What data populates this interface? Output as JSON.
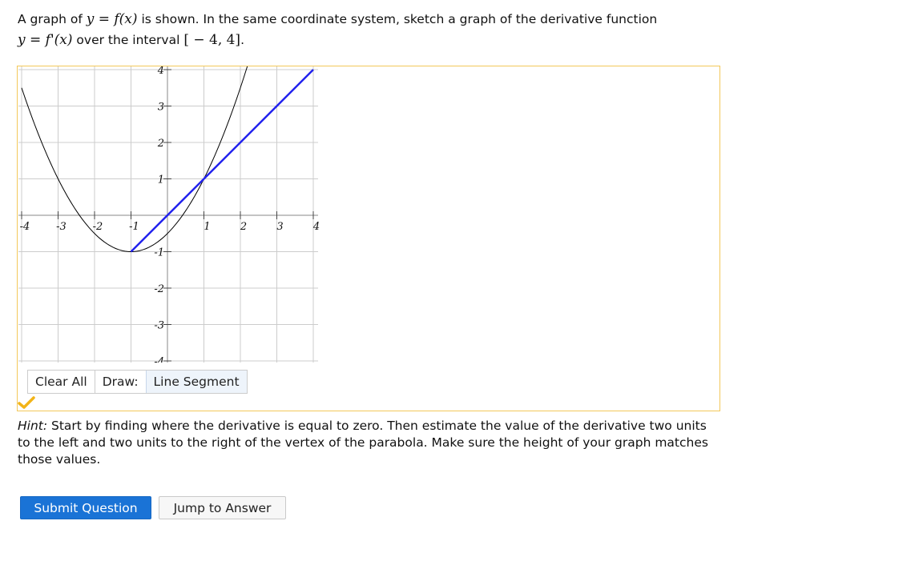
{
  "question": {
    "p1": "A graph of ",
    "m1": "y",
    "m2": " = ",
    "m3": "f",
    "m4": "(x)",
    "p2": " is shown. In the same coordinate system, sketch a graph of the derivative function",
    "m5": "y",
    "m6": " = ",
    "m7": "f",
    "m8": "'(x)",
    "p3": " over the interval ",
    "m9": "[ − 4, 4]",
    "p4": "."
  },
  "graph": {
    "xlim": [
      -4,
      4
    ],
    "ylim": [
      -4,
      4
    ],
    "x_ticks": [
      "-4",
      "-3",
      "-2",
      "-1",
      "1",
      "2",
      "3",
      "4"
    ],
    "y_ticks": [
      "4",
      "3",
      "2",
      "1",
      "-1",
      "-2",
      "-3",
      "-4"
    ],
    "parabola_vertex": [
      -1,
      -1
    ],
    "parabola_a": 0.5,
    "parabola_color": "#000000",
    "segment": {
      "x1": -1,
      "y1": -1,
      "x2": 4,
      "y2": 4,
      "color": "#2222ee"
    },
    "grid_color": "#cccccc"
  },
  "toolbar": {
    "clear_label": "Clear All",
    "draw_label": "Draw:",
    "tool_label": "Line Segment"
  },
  "status": {
    "icon": "checkmark-icon",
    "color": "#f2b418"
  },
  "hint": {
    "label": "Hint:",
    "text": " Start by finding where the derivative is equal to zero. Then estimate the value of the derivative two units to the left and two units to the right of the vertex of the parabola. Make sure the height of your graph matches those values."
  },
  "buttons": {
    "submit_label": "Submit Question",
    "jump_label": "Jump to Answer"
  }
}
